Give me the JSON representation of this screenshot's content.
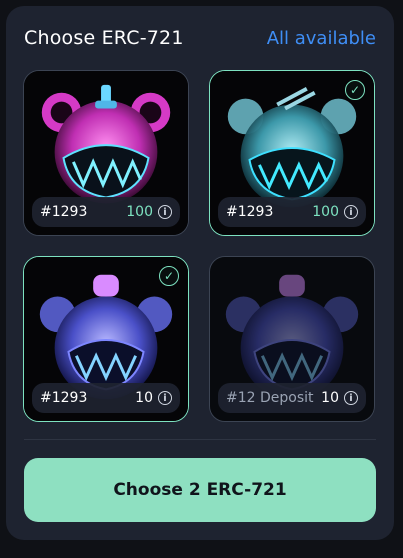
{
  "header": {
    "title": "Choose ERC-721",
    "all_available": "All available"
  },
  "cards": [
    {
      "id": "#1293",
      "amount": "100",
      "selected": false,
      "disabled": false,
      "theme": "pink"
    },
    {
      "id": "#1293",
      "amount": "100",
      "selected": true,
      "disabled": false,
      "theme": "cyan"
    },
    {
      "id": "#1293",
      "amount": "10",
      "selected": true,
      "disabled": false,
      "theme": "blue"
    },
    {
      "id": "#12 Deposit",
      "amount": "10",
      "selected": false,
      "disabled": true,
      "theme": "blue"
    }
  ],
  "cta": {
    "label": "Choose 2 ERC-721"
  },
  "colors": {
    "accent": "#7de2c0",
    "link": "#3f8ef5",
    "cta_bg": "#8ee0c1",
    "panel": "#1e2330"
  }
}
